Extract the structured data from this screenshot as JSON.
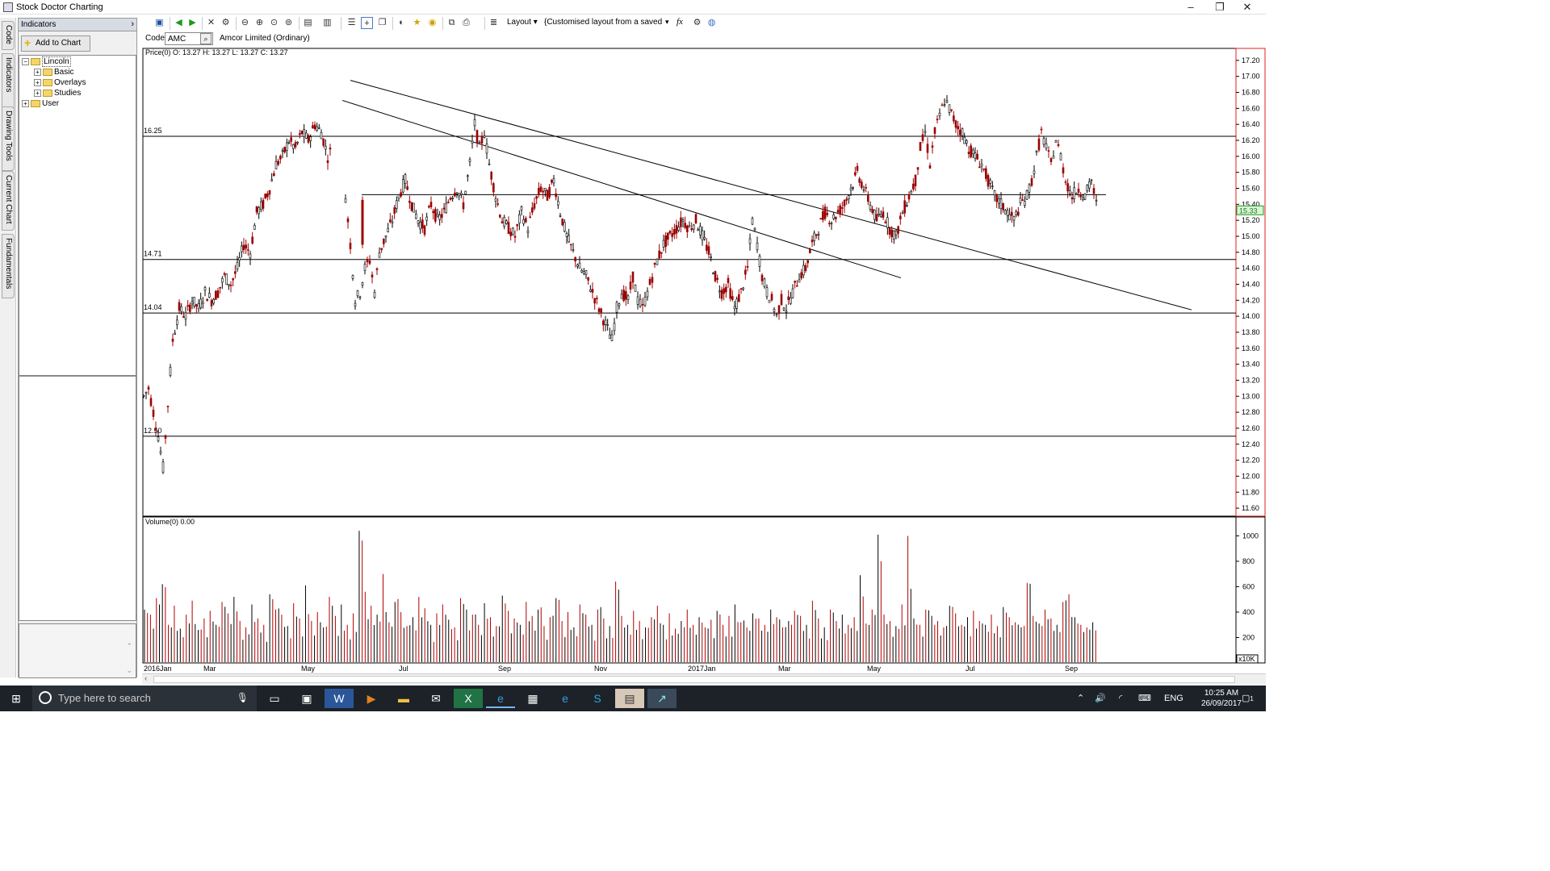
{
  "window": {
    "title": "Stock Doctor Charting",
    "buttons": {
      "minimize": "–",
      "maximize": "❐",
      "close": "✕"
    }
  },
  "left_tabs": [
    "Code",
    "Indicators",
    "Drawing Tools",
    "Current Chart",
    "Fundamentals"
  ],
  "panel": {
    "header": "Indicators",
    "add_button": "Add to Chart",
    "tree": [
      {
        "label": "Lincoln",
        "level": 0,
        "expanded": true
      },
      {
        "label": "Basic",
        "level": 1,
        "expanded": false
      },
      {
        "label": "Overlays",
        "level": 1,
        "expanded": false
      },
      {
        "label": "Studies",
        "level": 1,
        "expanded": false
      },
      {
        "label": "User",
        "level": 0,
        "expanded": false
      }
    ]
  },
  "toolbar": {
    "layout_label": "Layout",
    "layout_value": "{Customised layout from a saved",
    "fx_label": "fx"
  },
  "codebar": {
    "code_label": "Code",
    "code_value": "AMC",
    "security_name": "Amcor Limited (Ordinary)"
  },
  "chart_data": {
    "type": "candlestick",
    "price_header": "Price(0)  O: 13.27  H: 13.27  L: 13.27  C: 13.27",
    "volume_header": "Volume(0)  0.00",
    "y_range": [
      11.5,
      17.35
    ],
    "y_ticks": [
      "17.20",
      "17.00",
      "16.80",
      "16.60",
      "16.40",
      "16.20",
      "16.00",
      "15.80",
      "15.60",
      "15.40",
      "15.20",
      "15.00",
      "14.80",
      "14.60",
      "14.40",
      "14.20",
      "14.00",
      "13.80",
      "13.60",
      "13.40",
      "13.20",
      "13.00",
      "12.80",
      "12.60",
      "12.40",
      "12.20",
      "12.00",
      "11.80",
      "11.60"
    ],
    "last_price_label": "15.33",
    "x_tick_labels": [
      "2016Jan",
      "Mar",
      "May",
      "Jul",
      "Sep",
      "Nov",
      "2017Jan",
      "Mar",
      "May",
      "Jul",
      "Sep"
    ],
    "support_levels": [
      {
        "label": "16.25",
        "value": 16.25
      },
      {
        "label": "14.71",
        "value": 14.71
      },
      {
        "label": "14.04",
        "value": 14.04
      },
      {
        "label": "12.50",
        "value": 12.5
      }
    ],
    "partial_levels": [
      {
        "value": 15.52
      }
    ],
    "price_path": [
      [
        0,
        13.0
      ],
      [
        6,
        13.1
      ],
      [
        12,
        12.8
      ],
      [
        18,
        12.5
      ],
      [
        24,
        12.1
      ],
      [
        30,
        12.9
      ],
      [
        36,
        13.7
      ],
      [
        44,
        14.1
      ],
      [
        52,
        14.0
      ],
      [
        60,
        14.2
      ],
      [
        68,
        14.1
      ],
      [
        76,
        14.3
      ],
      [
        84,
        14.2
      ],
      [
        92,
        14.3
      ],
      [
        100,
        14.5
      ],
      [
        108,
        14.4
      ],
      [
        116,
        14.6
      ],
      [
        124,
        14.9
      ],
      [
        132,
        14.8
      ],
      [
        140,
        15.3
      ],
      [
        148,
        15.4
      ],
      [
        156,
        15.6
      ],
      [
        164,
        15.9
      ],
      [
        172,
        16.0
      ],
      [
        180,
        16.2
      ],
      [
        188,
        16.1
      ],
      [
        196,
        16.3
      ],
      [
        204,
        16.2
      ],
      [
        212,
        16.4
      ],
      [
        220,
        16.3
      ],
      [
        228,
        16.0
      ],
      [
        234,
        16.1
      ],
      [
        250,
        15.5
      ],
      [
        256,
        14.9
      ],
      [
        262,
        14.2
      ],
      [
        268,
        14.3
      ],
      [
        274,
        14.6
      ],
      [
        280,
        14.7
      ],
      [
        286,
        14.3
      ],
      [
        292,
        14.8
      ],
      [
        300,
        15.0
      ],
      [
        308,
        15.2
      ],
      [
        316,
        15.5
      ],
      [
        324,
        15.7
      ],
      [
        332,
        15.4
      ],
      [
        340,
        15.2
      ],
      [
        348,
        15.1
      ],
      [
        356,
        15.4
      ],
      [
        364,
        15.2
      ],
      [
        372,
        15.3
      ],
      [
        380,
        15.5
      ],
      [
        388,
        15.6
      ],
      [
        396,
        15.4
      ],
      [
        404,
        15.9
      ],
      [
        410,
        16.4
      ],
      [
        416,
        16.1
      ],
      [
        422,
        16.3
      ],
      [
        428,
        15.9
      ],
      [
        436,
        15.5
      ],
      [
        444,
        15.2
      ],
      [
        452,
        15.1
      ],
      [
        460,
        15.0
      ],
      [
        468,
        15.3
      ],
      [
        476,
        15.1
      ],
      [
        484,
        15.4
      ],
      [
        492,
        15.6
      ],
      [
        500,
        15.5
      ],
      [
        508,
        15.7
      ],
      [
        516,
        15.3
      ],
      [
        524,
        15.0
      ],
      [
        532,
        14.8
      ],
      [
        540,
        14.6
      ],
      [
        548,
        14.5
      ],
      [
        556,
        14.3
      ],
      [
        564,
        14.1
      ],
      [
        572,
        13.9
      ],
      [
        580,
        13.7
      ],
      [
        586,
        14.1
      ],
      [
        592,
        14.3
      ],
      [
        600,
        14.2
      ],
      [
        606,
        14.5
      ],
      [
        612,
        14.2
      ],
      [
        618,
        14.1
      ],
      [
        624,
        14.3
      ],
      [
        630,
        14.5
      ],
      [
        636,
        14.7
      ],
      [
        644,
        14.9
      ],
      [
        652,
        15.0
      ],
      [
        660,
        15.1
      ],
      [
        668,
        15.2
      ],
      [
        676,
        15.1
      ],
      [
        684,
        15.2
      ],
      [
        692,
        15.0
      ],
      [
        700,
        14.8
      ],
      [
        708,
        14.5
      ],
      [
        716,
        14.3
      ],
      [
        724,
        14.4
      ],
      [
        732,
        14.1
      ],
      [
        740,
        14.3
      ],
      [
        748,
        14.6
      ],
      [
        754,
        15.2
      ],
      [
        760,
        14.9
      ],
      [
        766,
        14.5
      ],
      [
        772,
        14.3
      ],
      [
        778,
        14.2
      ],
      [
        784,
        14.0
      ],
      [
        790,
        14.2
      ],
      [
        796,
        14.1
      ],
      [
        804,
        14.3
      ],
      [
        812,
        14.5
      ],
      [
        820,
        14.6
      ],
      [
        828,
        14.9
      ],
      [
        836,
        15.1
      ],
      [
        844,
        15.3
      ],
      [
        852,
        15.2
      ],
      [
        860,
        15.3
      ],
      [
        868,
        15.4
      ],
      [
        876,
        15.6
      ],
      [
        884,
        15.8
      ],
      [
        892,
        15.6
      ],
      [
        900,
        15.4
      ],
      [
        908,
        15.2
      ],
      [
        916,
        15.3
      ],
      [
        924,
        15.1
      ],
      [
        932,
        15.0
      ],
      [
        940,
        15.3
      ],
      [
        948,
        15.5
      ],
      [
        956,
        15.7
      ],
      [
        962,
        16.1
      ],
      [
        968,
        16.3
      ],
      [
        974,
        15.9
      ],
      [
        980,
        16.3
      ],
      [
        986,
        16.5
      ],
      [
        992,
        16.7
      ],
      [
        998,
        16.6
      ],
      [
        1006,
        16.4
      ],
      [
        1014,
        16.3
      ],
      [
        1022,
        16.1
      ],
      [
        1030,
        16.0
      ],
      [
        1038,
        15.9
      ],
      [
        1046,
        15.7
      ],
      [
        1054,
        15.5
      ],
      [
        1062,
        15.4
      ],
      [
        1070,
        15.3
      ],
      [
        1078,
        15.2
      ],
      [
        1086,
        15.4
      ],
      [
        1094,
        15.5
      ],
      [
        1100,
        15.7
      ],
      [
        1106,
        16.0
      ],
      [
        1112,
        16.3
      ],
      [
        1118,
        16.1
      ],
      [
        1124,
        15.9
      ],
      [
        1130,
        16.2
      ],
      [
        1136,
        16.0
      ],
      [
        1142,
        15.7
      ],
      [
        1150,
        15.5
      ],
      [
        1158,
        15.6
      ],
      [
        1166,
        15.5
      ],
      [
        1174,
        15.7
      ],
      [
        1180,
        15.4
      ],
      [
        1184,
        15.3
      ]
    ],
    "volume_bars": [
      420,
      380,
      510,
      620,
      300,
      450,
      270,
      380,
      490,
      260,
      350,
      410,
      300,
      480,
      390,
      520,
      330,
      280,
      460,
      350,
      300,
      540,
      420,
      380,
      290,
      470,
      350,
      610,
      330,
      400,
      280,
      520,
      370,
      460,
      300,
      390,
      1040,
      560,
      450,
      380,
      700,
      320,
      480,
      400,
      290,
      360,
      520,
      430,
      300,
      390,
      460,
      340,
      280,
      510,
      420,
      380,
      300,
      470,
      360,
      290,
      530,
      410,
      350,
      300,
      480,
      370,
      420,
      290,
      360,
      510,
      330,
      400,
      280,
      460,
      380,
      300,
      420,
      350,
      290,
      640,
      370,
      300,
      410,
      330,
      280,
      360,
      450,
      300,
      390,
      270,
      330,
      420,
      300,
      360,
      280,
      340,
      410,
      300,
      370,
      460,
      320,
      280,
      390,
      350,
      300,
      420,
      360,
      280,
      330,
      410,
      370,
      300,
      490,
      350,
      280,
      420,
      330,
      380,
      300,
      360,
      690,
      310,
      420,
      1010,
      380,
      330,
      290,
      460,
      1000,
      350,
      300,
      420,
      370,
      330,
      280,
      450,
      390,
      300,
      360,
      410,
      330,
      300,
      380,
      290,
      440,
      360,
      320,
      280,
      630,
      370,
      310,
      420,
      350,
      300,
      480,
      540,
      360,
      300,
      280,
      320
    ],
    "volume_ticks": [
      "1000",
      "800",
      "600",
      "400",
      "200"
    ],
    "volume_unit": "x10K",
    "trendlines": [
      {
        "x1": 258,
        "y1": 100,
        "x2": 1300,
        "y2": 348
      },
      {
        "x1": 248,
        "y1": 77,
        "x2": 940,
        "y2": 290
      }
    ]
  },
  "taskbar": {
    "search_placeholder": "Type here to search",
    "language": "ENG",
    "time": "10:25 AM",
    "date": "26/09/2017",
    "notification_count": "1"
  }
}
